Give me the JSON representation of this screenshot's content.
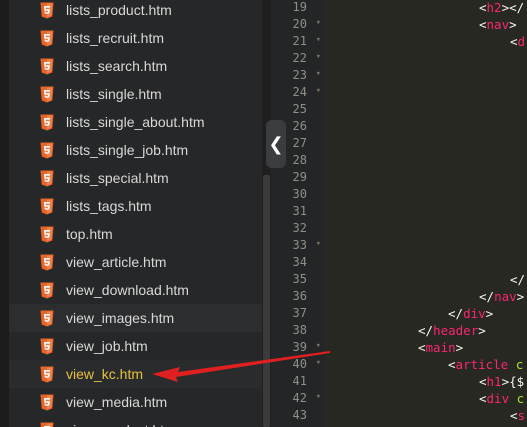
{
  "files": [
    {
      "name": "lists_product.htm",
      "state": "normal"
    },
    {
      "name": "lists_recruit.htm",
      "state": "normal"
    },
    {
      "name": "lists_search.htm",
      "state": "normal"
    },
    {
      "name": "lists_single.htm",
      "state": "normal"
    },
    {
      "name": "lists_single_about.htm",
      "state": "normal"
    },
    {
      "name": "lists_single_job.htm",
      "state": "normal"
    },
    {
      "name": "lists_special.htm",
      "state": "normal"
    },
    {
      "name": "lists_tags.htm",
      "state": "normal"
    },
    {
      "name": "top.htm",
      "state": "normal"
    },
    {
      "name": "view_article.htm",
      "state": "normal"
    },
    {
      "name": "view_download.htm",
      "state": "normal"
    },
    {
      "name": "view_images.htm",
      "state": "hover"
    },
    {
      "name": "view_job.htm",
      "state": "normal"
    },
    {
      "name": "view_kc.htm",
      "state": "active"
    },
    {
      "name": "view_media.htm",
      "state": "normal"
    },
    {
      "name": "view_product.htm",
      "state": "normal"
    }
  ],
  "file_icon": "html5-icon",
  "collapse_handle_icon": "chevron-left-icon",
  "line_numbers": [
    {
      "n": "19",
      "fold": false
    },
    {
      "n": "20",
      "fold": true
    },
    {
      "n": "21",
      "fold": true
    },
    {
      "n": "22",
      "fold": true
    },
    {
      "n": "23",
      "fold": true
    },
    {
      "n": "24",
      "fold": true
    },
    {
      "n": "25",
      "fold": false
    },
    {
      "n": "26",
      "fold": false
    },
    {
      "n": "27",
      "fold": false
    },
    {
      "n": "28",
      "fold": false
    },
    {
      "n": "29",
      "fold": false
    },
    {
      "n": "30",
      "fold": false
    },
    {
      "n": "31",
      "fold": false
    },
    {
      "n": "32",
      "fold": false
    },
    {
      "n": "33",
      "fold": true
    },
    {
      "n": "34",
      "fold": false
    },
    {
      "n": "35",
      "fold": false
    },
    {
      "n": "36",
      "fold": false
    },
    {
      "n": "37",
      "fold": false
    },
    {
      "n": "38",
      "fold": false
    },
    {
      "n": "39",
      "fold": true
    },
    {
      "n": "40",
      "fold": true
    },
    {
      "n": "41",
      "fold": false
    },
    {
      "n": "42",
      "fold": true
    },
    {
      "n": "43",
      "fold": false
    }
  ],
  "code": [
    {
      "indent": "i5",
      "tokens": [
        {
          "c": "br",
          "v": "<"
        },
        {
          "c": "tag",
          "v": "h2"
        },
        {
          "c": "br",
          "v": "></"
        }
      ]
    },
    {
      "indent": "i5",
      "tokens": [
        {
          "c": "br",
          "v": "<"
        },
        {
          "c": "tag",
          "v": "nav"
        },
        {
          "c": "br",
          "v": ">"
        }
      ]
    },
    {
      "indent": "i6",
      "tokens": [
        {
          "c": "br",
          "v": "<"
        },
        {
          "c": "tag",
          "v": "d"
        }
      ]
    },
    {
      "indent": "i0",
      "tokens": []
    },
    {
      "indent": "i0",
      "tokens": []
    },
    {
      "indent": "i0",
      "tokens": []
    },
    {
      "indent": "i0",
      "tokens": []
    },
    {
      "indent": "i0",
      "tokens": []
    },
    {
      "indent": "i0",
      "tokens": []
    },
    {
      "indent": "i0",
      "tokens": []
    },
    {
      "indent": "i0",
      "tokens": []
    },
    {
      "indent": "i0",
      "tokens": []
    },
    {
      "indent": "i0",
      "tokens": []
    },
    {
      "indent": "i0",
      "tokens": []
    },
    {
      "indent": "i0",
      "tokens": []
    },
    {
      "indent": "i0",
      "tokens": []
    },
    {
      "indent": "i6",
      "tokens": [
        {
          "c": "br",
          "v": "</"
        }
      ]
    },
    {
      "indent": "i5",
      "tokens": [
        {
          "c": "br",
          "v": "</"
        },
        {
          "c": "tag",
          "v": "nav"
        },
        {
          "c": "br",
          "v": ">"
        }
      ]
    },
    {
      "indent": "i4",
      "tokens": [
        {
          "c": "br",
          "v": "</"
        },
        {
          "c": "tag",
          "v": "div"
        },
        {
          "c": "br",
          "v": ">"
        }
      ]
    },
    {
      "indent": "i3",
      "tokens": [
        {
          "c": "br",
          "v": "</"
        },
        {
          "c": "tag",
          "v": "header"
        },
        {
          "c": "br",
          "v": ">"
        }
      ]
    },
    {
      "indent": "i3",
      "tokens": [
        {
          "c": "br",
          "v": "<"
        },
        {
          "c": "tag",
          "v": "main"
        },
        {
          "c": "br",
          "v": ">"
        }
      ]
    },
    {
      "indent": "i4",
      "tokens": [
        {
          "c": "br",
          "v": "<"
        },
        {
          "c": "tag",
          "v": "article"
        },
        {
          "c": "br",
          "v": " "
        },
        {
          "c": "attr",
          "v": "c"
        }
      ]
    },
    {
      "indent": "i5",
      "tokens": [
        {
          "c": "br",
          "v": "<"
        },
        {
          "c": "tag",
          "v": "h1"
        },
        {
          "c": "br",
          "v": ">{$"
        }
      ]
    },
    {
      "indent": "i5",
      "tokens": [
        {
          "c": "br",
          "v": "<"
        },
        {
          "c": "tag",
          "v": "div"
        },
        {
          "c": "br",
          "v": " "
        },
        {
          "c": "attr",
          "v": "c"
        }
      ]
    },
    {
      "indent": "i6",
      "tokens": [
        {
          "c": "br",
          "v": "<"
        },
        {
          "c": "tag",
          "v": "s"
        }
      ]
    }
  ]
}
